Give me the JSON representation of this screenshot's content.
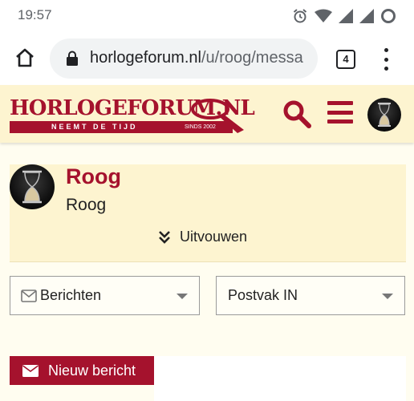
{
  "status_bar": {
    "time": "19:57",
    "icons": [
      "alarm-icon",
      "wifi-icon",
      "signal-icon",
      "signal-icon",
      "battery-icon"
    ]
  },
  "browser": {
    "url_domain": "horlogeforum.nl",
    "url_path": "/u/roog/messa",
    "tab_count": "4",
    "icons": [
      "home-icon",
      "lock-icon",
      "tabs-icon",
      "more-vert-icon"
    ]
  },
  "site": {
    "logo_text": "HORLOGEFORUM.NL",
    "logo_tagline": "NEEMT DE TIJD",
    "logo_since": "SINDS 2002",
    "brand_color": "#a5122d",
    "header_bg": "#fdf4d0",
    "icons": [
      "search-icon",
      "hamburger-menu-icon",
      "user-avatar"
    ]
  },
  "profile": {
    "name": "Roog",
    "subtitle": "Roog",
    "expand_label": "Uitvouwen",
    "icons": [
      "double-chevron-down-icon"
    ]
  },
  "filters": {
    "left_select": {
      "value": "Berichten",
      "icon": "envelope-icon"
    },
    "right_select": {
      "value": "Postvak IN"
    }
  },
  "actions": {
    "new_message_label": "Nieuw bericht",
    "icon": "envelope-icon"
  }
}
